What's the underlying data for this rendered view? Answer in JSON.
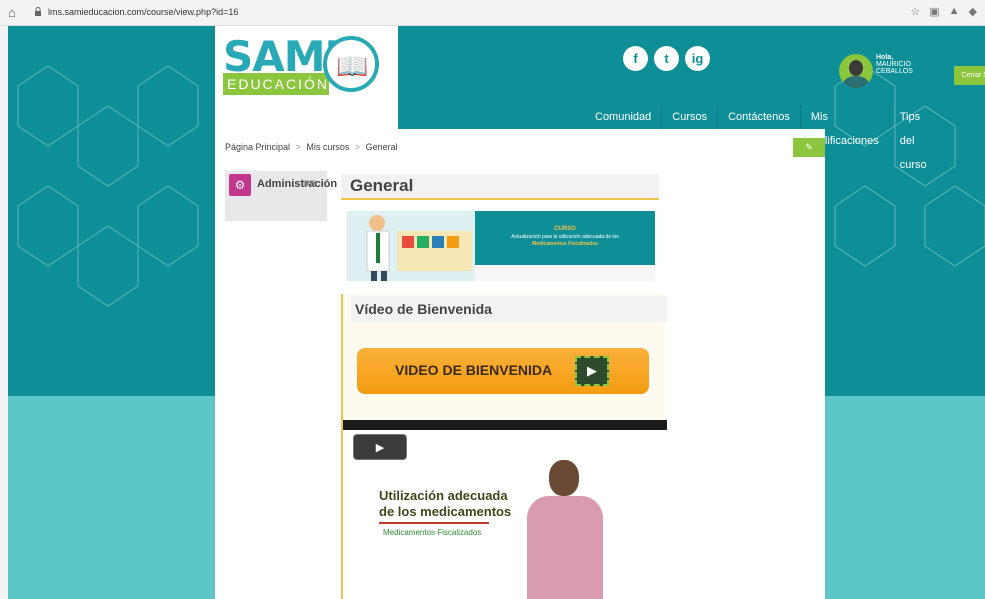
{
  "browser": {
    "url": "lms.samieducacion.com/course/view.php?id=16"
  },
  "logo": {
    "name": "SAMI",
    "tagline": "EDUCACIÓN"
  },
  "header": {
    "social": [
      "f",
      "t",
      "ig"
    ],
    "greeting_bold": "Hola,",
    "user_name": "MAURICIO CEBALLOS",
    "logout_label": "Cerrar Sesión"
  },
  "nav": {
    "items": [
      "Comunidad",
      "Cursos",
      "Contáctenos",
      "Mis Calificaciones",
      "Tips del curso"
    ]
  },
  "breadcrumb": {
    "items": [
      "Página Principal",
      "Mis cursos",
      "General"
    ],
    "separator": ">"
  },
  "admin": {
    "title": "Administración"
  },
  "course": {
    "title": "General",
    "banner": {
      "line1": "CURSO",
      "line2": "Actualización para la utilización adecuada de los",
      "line3": "Medicamentos Fiscalizados"
    }
  },
  "video": {
    "section_title": "Vídeo de Bienvenida",
    "button_label": "VIDEO DE BIENVENIDA",
    "player_title_1": "Utilización adecuada",
    "player_title_2": "de los medicamentos",
    "player_subtitle": "Medicamentos Fiscalizados"
  },
  "colors": {
    "teal": "#0e8f98",
    "light_teal": "#5bc5c7",
    "green": "#8cc63f",
    "orange": "#f39c12",
    "magenta": "#c2378c"
  }
}
